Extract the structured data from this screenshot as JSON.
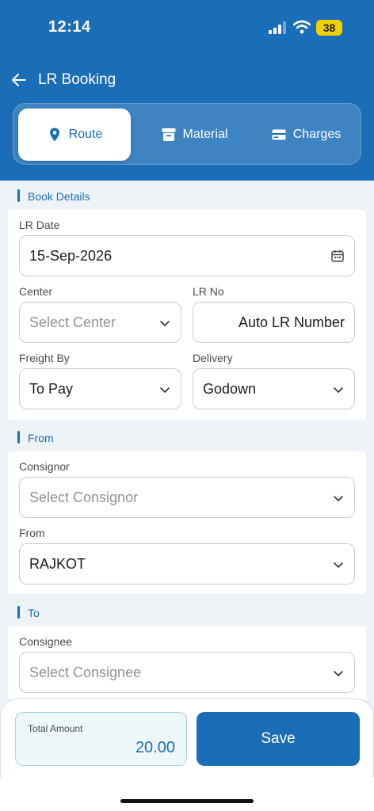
{
  "status_bar": {
    "time": "12:14",
    "battery": "38"
  },
  "header": {
    "title": "LR Booking"
  },
  "tabs": [
    {
      "label": "Route",
      "icon": "location-pin-icon",
      "active": true
    },
    {
      "label": "Material",
      "icon": "archive-box-icon",
      "active": false
    },
    {
      "label": "Charges",
      "icon": "card-icon",
      "active": false
    }
  ],
  "sections": {
    "book_details": {
      "title": "Book Details",
      "lr_date": {
        "label": "LR Date",
        "value": "15-Sep-2026"
      },
      "center": {
        "label": "Center",
        "placeholder": "Select Center"
      },
      "lr_no": {
        "label": "LR No",
        "value": "Auto LR Number"
      },
      "freight_by": {
        "label": "Freight By",
        "value": "To Pay"
      },
      "delivery": {
        "label": "Delivery",
        "value": "Godown"
      }
    },
    "from": {
      "title": "From",
      "consignor": {
        "label": "Consignor",
        "placeholder": "Select Consignor"
      },
      "from_city": {
        "label": "From",
        "value": "RAJKOT"
      }
    },
    "to": {
      "title": "To",
      "consignee": {
        "label": "Consignee",
        "placeholder": "Select Consignee"
      }
    }
  },
  "footer": {
    "total_label": "Total Amount",
    "total_value": "20.00",
    "save_label": "Save"
  },
  "colors": {
    "primary": "#1a6db7",
    "battery": "#f5d000",
    "background": "#eef3f8"
  }
}
